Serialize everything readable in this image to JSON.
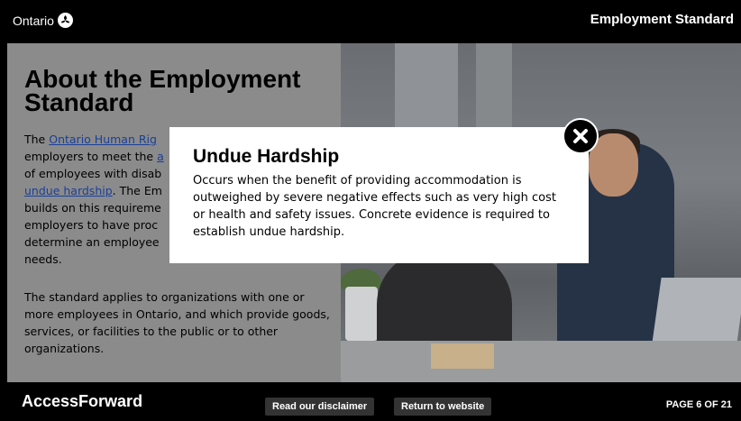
{
  "header": {
    "brand": "Ontario",
    "course_title": "Employment Standard"
  },
  "main": {
    "heading": "About the Employment Standard",
    "para1_lead": "The ",
    "para1_link1": "Ontario Human Rig",
    "para1_text1": "employers to meet the ",
    "para1_link2": "a",
    "para1_text2": "of employees with disab",
    "para1_link3": "undue hardship",
    "para1_text3": ". The Em",
    "para1_text4": "builds on this requireme",
    "para1_text5": "employers to have proc",
    "para1_text6": "determine an employee",
    "para1_text7": "needs.",
    "para2": "The standard applies to organizations with one or more employees in Ontario, and which provide goods, services, or facilities to the public or to other organizations."
  },
  "modal": {
    "title": "Undue Hardship",
    "body": "Occurs when the benefit of providing accommodation is outweighed by severe negative effects such as very high cost or health and safety issues. Concrete evidence is required to establish undue hardship.",
    "close_icon": "close-icon"
  },
  "footer": {
    "brand": "AccessForward",
    "disclaimer_label": "Read our disclaimer",
    "return_label": "Return to website",
    "page_indicator": "PAGE 6 OF 21"
  },
  "colors": {
    "link": "#1a3f99",
    "overlay_panel": "#8b8b8b",
    "bar": "#000000",
    "button": "#333333"
  }
}
